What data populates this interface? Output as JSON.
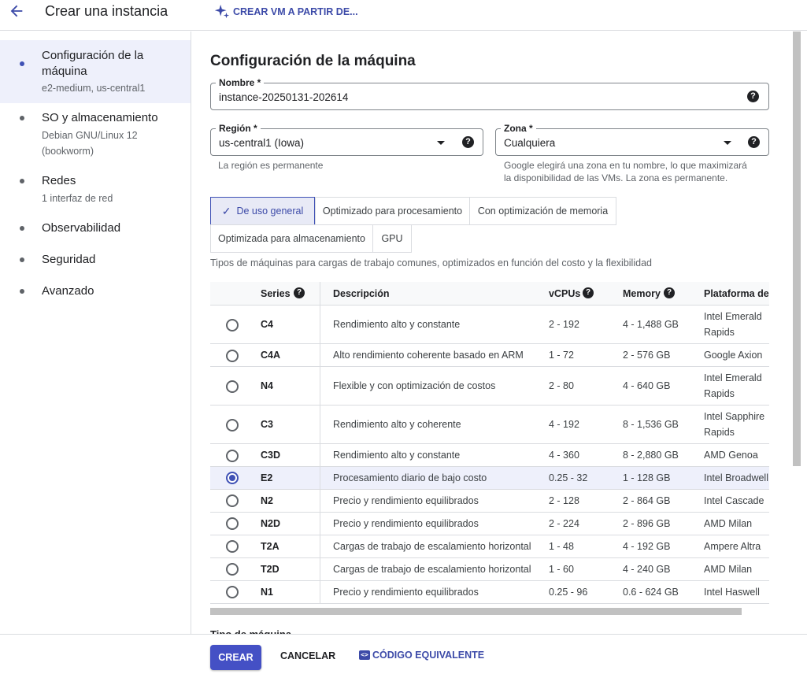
{
  "header": {
    "title": "Crear una instancia",
    "ai_button": "CREAR VM A PARTIR DE..."
  },
  "sidebar": {
    "items": [
      {
        "label": "Configuración de la máquina",
        "sub": "e2-medium, us-central1",
        "active": true
      },
      {
        "label": "SO y almacenamiento",
        "sub": "Debian GNU/Linux 12 (bookworm)"
      },
      {
        "label": "Redes",
        "sub": "1 interfaz de red"
      },
      {
        "label": "Observabilidad",
        "sub": ""
      },
      {
        "label": "Seguridad",
        "sub": ""
      },
      {
        "label": "Avanzado",
        "sub": ""
      }
    ]
  },
  "main": {
    "title": "Configuración de la máquina",
    "name_field": {
      "label": "Nombre *",
      "value": "instance-20250131-202614"
    },
    "region_field": {
      "label": "Región *",
      "value": "us-central1 (Iowa)",
      "hint": "La región es permanente"
    },
    "zone_field": {
      "label": "Zona *",
      "value": "Cualquiera",
      "hint": "Google elegirá una zona en tu nombre, lo que maximizará la disponibilidad de las VMs. La zona es permanente."
    },
    "chips": [
      {
        "label": "De uso general",
        "selected": true
      },
      {
        "label": "Optimizado para procesamiento"
      },
      {
        "label": "Con optimización de memoria"
      },
      {
        "label": "Optimizada para almacenamiento"
      },
      {
        "label": "GPU"
      }
    ],
    "category_description": "Tipos de máquinas para cargas de trabajo comunes, optimizados en función del costo y la flexibilidad",
    "table": {
      "headers": {
        "series": "Series",
        "description": "Descripción",
        "vcpus": "vCPUs",
        "memory": "Memory",
        "platform": "Plataforma de C"
      },
      "rows": [
        {
          "series": "C4",
          "description": "Rendimiento alto y constante",
          "vcpus": "2 - 192",
          "memory": "4 - 1,488 GB",
          "platform": "Intel Emerald Rapids"
        },
        {
          "series": "C4A",
          "description": "Alto rendimiento coherente basado en ARM",
          "vcpus": "1 - 72",
          "memory": "2 - 576 GB",
          "platform": "Google Axion"
        },
        {
          "series": "N4",
          "description": "Flexible y con optimización de costos",
          "vcpus": "2 - 80",
          "memory": "4 - 640 GB",
          "platform": "Intel Emerald Rapids"
        },
        {
          "series": "C3",
          "description": "Rendimiento alto y coherente",
          "vcpus": "4 - 192",
          "memory": "8 - 1,536 GB",
          "platform": "Intel Sapphire Rapids"
        },
        {
          "series": "C3D",
          "description": "Rendimiento alto y constante",
          "vcpus": "4 - 360",
          "memory": "8 - 2,880 GB",
          "platform": "AMD Genoa"
        },
        {
          "series": "E2",
          "description": "Procesamiento diario de bajo costo",
          "vcpus": "0.25 - 32",
          "memory": "1 - 128 GB",
          "platform": "Intel Broadwell",
          "selected": true
        },
        {
          "series": "N2",
          "description": "Precio y rendimiento equilibrados",
          "vcpus": "2 - 128",
          "memory": "2 - 864 GB",
          "platform": "Intel Cascade L"
        },
        {
          "series": "N2D",
          "description": "Precio y rendimiento equilibrados",
          "vcpus": "2 - 224",
          "memory": "2 - 896 GB",
          "platform": "AMD Milan"
        },
        {
          "series": "T2A",
          "description": "Cargas de trabajo de escalamiento horizontal",
          "vcpus": "1 - 48",
          "memory": "4 - 192 GB",
          "platform": "Ampere Altra"
        },
        {
          "series": "T2D",
          "description": "Cargas de trabajo de escalamiento horizontal",
          "vcpus": "1 - 60",
          "memory": "4 - 240 GB",
          "platform": "AMD Milan"
        },
        {
          "series": "N1",
          "description": "Precio y rendimiento equilibrados",
          "vcpus": "0.25 - 96",
          "memory": "0.6 - 624 GB",
          "platform": "Intel Haswell"
        }
      ]
    },
    "cutoff_text": "Tipo de máquina"
  },
  "footer": {
    "create": "CREAR",
    "cancel": "CANCELAR",
    "code": "CÓDIGO EQUIVALENTE"
  },
  "colors": {
    "accent": "#3f51b5",
    "accent_text": "#3c4aa8",
    "selected_bg": "#eef0fb"
  }
}
